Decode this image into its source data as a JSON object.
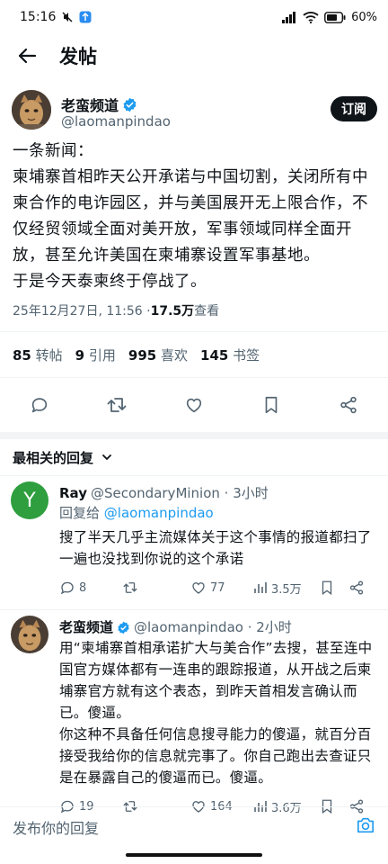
{
  "status_bar": {
    "time": "15:16",
    "battery": "60%"
  },
  "header": {
    "title": "发帖"
  },
  "tweet": {
    "author_name": "老蛮频道",
    "author_handle": "@laomanpindao",
    "subscribe_label": "订阅",
    "body_lines": [
      "一条新闻：",
      "柬埔寨首相昨天公开承诺与中国切割，关闭所有中柬合作的电诈园区，并与美国展开无上限合作，不仅经贸领域全面对美开放，军事领域同样全面开放，甚至允许美国在柬埔寨设置军事基地。",
      "于是今天泰柬终于停战了。"
    ],
    "timestamp": "25年12月27日, 11:56 · ",
    "views_count": "17.5万",
    "views_label": " 查看",
    "stats": {
      "retweets_count": "85",
      "retweets_label": "转帖",
      "quotes_count": "9",
      "quotes_label": "引用",
      "likes_count": "995",
      "likes_label": "喜欢",
      "bookmarks_count": "145",
      "bookmarks_label": "书签"
    }
  },
  "replies_header": {
    "label": "最相关的回复"
  },
  "replies": [
    {
      "name": "Ray",
      "handle": "@SecondaryMinion · 3小时",
      "reply_to_prefix": "回复给 ",
      "reply_to_handle": "@laomanpindao",
      "text_lines": [
        "搜了半天几乎主流媒体关于这个事情的报道都扫了一遍也没找到你说的这个承诺"
      ],
      "replies_count": "8",
      "likes_count": "77",
      "views_count": "3.5万",
      "avatar_letter": "Y",
      "avatar_color": "#2e9e3e"
    },
    {
      "name": "老蛮频道",
      "handle": "@laomanpindao · 2小时",
      "text_lines": [
        "用“柬埔寨首相承诺扩大与美合作”去搜，甚至连中国官方媒体都有一连串的跟踪报道，从开战之后柬埔寨官方就有这个表态，到昨天首相发言确认而已。傻逼。",
        "你这种不具备任何信息搜寻能力的傻逼，就百分百接受我给你的信息就完事了。你自己跑出去查证只是在暴露自己的傻逼而已。傻逼。"
      ],
      "replies_count": "19",
      "likes_count": "164",
      "views_count": "3.6万"
    }
  ],
  "compose": {
    "placeholder": "发布你的回复"
  },
  "colors": {
    "accent": "#1d9bf0",
    "text": "#0f1419",
    "muted": "#536471",
    "verified": "#1d9bf0"
  }
}
